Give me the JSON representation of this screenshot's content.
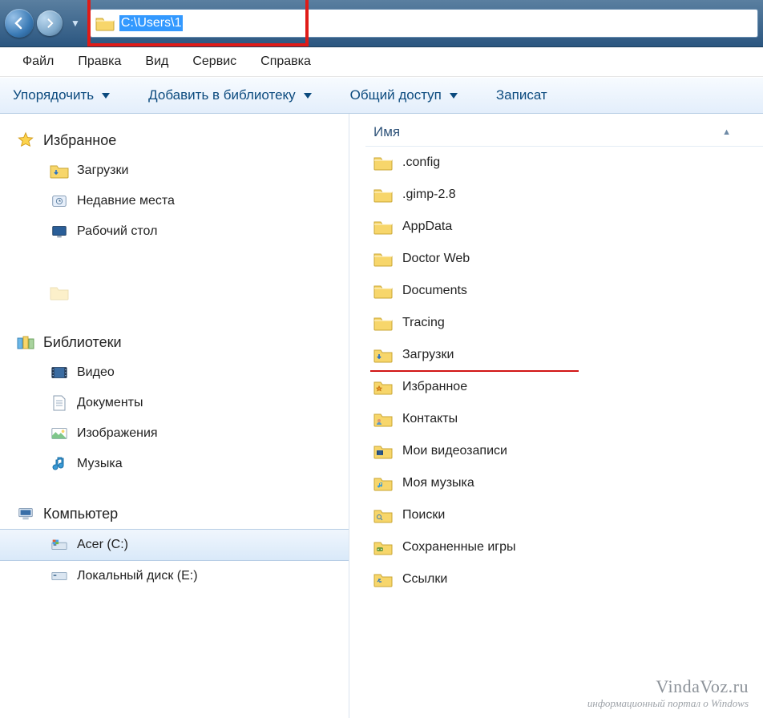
{
  "address": {
    "path": "C:\\Users\\1"
  },
  "menu": {
    "file": "Файл",
    "edit": "Правка",
    "view": "Вид",
    "service": "Сервис",
    "help": "Справка"
  },
  "toolbar": {
    "organize": "Упорядочить",
    "add_library": "Добавить в библиотеку",
    "share": "Общий доступ",
    "burn": "Записат"
  },
  "column": {
    "name": "Имя"
  },
  "sidebar": {
    "favorites": {
      "label": "Избранное",
      "icon": "star"
    },
    "fav_items": [
      {
        "label": "Загрузки",
        "icon": "folder-down"
      },
      {
        "label": "Недавние места",
        "icon": "recent"
      },
      {
        "label": "Рабочий стол",
        "icon": "desktop"
      },
      {
        "label": "",
        "icon": "blank"
      },
      {
        "label": "",
        "icon": "folder"
      }
    ],
    "libraries": {
      "label": "Библиотеки",
      "icon": "libs"
    },
    "lib_items": [
      {
        "label": "Видео",
        "icon": "video"
      },
      {
        "label": "Документы",
        "icon": "docs"
      },
      {
        "label": "Изображения",
        "icon": "images"
      },
      {
        "label": "Музыка",
        "icon": "music"
      }
    ],
    "computer": {
      "label": "Компьютер",
      "icon": "computer"
    },
    "drives": [
      {
        "label": "Acer (C:)",
        "icon": "drive-win",
        "selected": true
      },
      {
        "label": "Локальный диск (E:)",
        "icon": "drive"
      }
    ]
  },
  "files": [
    {
      "label": ".config",
      "icon": "folder"
    },
    {
      "label": ".gimp-2.8",
      "icon": "folder"
    },
    {
      "label": "AppData",
      "icon": "folder"
    },
    {
      "label": "Doctor Web",
      "icon": "folder"
    },
    {
      "label": "Documents",
      "icon": "folder"
    },
    {
      "label": "Tracing",
      "icon": "folder"
    },
    {
      "label": "Загрузки",
      "icon": "folder-down",
      "underlined": true
    },
    {
      "label": "Избранное",
      "icon": "folder-star"
    },
    {
      "label": "Контакты",
      "icon": "folder-contacts"
    },
    {
      "label": "Мои видеозаписи",
      "icon": "folder-video"
    },
    {
      "label": "Моя музыка",
      "icon": "folder-music"
    },
    {
      "label": "Поиски",
      "icon": "folder-search"
    },
    {
      "label": "Сохраненные игры",
      "icon": "folder-games"
    },
    {
      "label": "Ссылки",
      "icon": "folder-links"
    }
  ],
  "watermark": {
    "site": "VindaVoz.ru",
    "tagline": "информационный портал о Windows"
  }
}
